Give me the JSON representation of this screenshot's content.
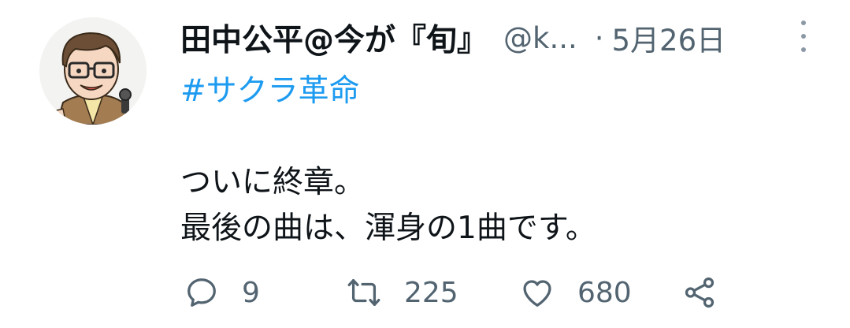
{
  "tweet": {
    "author": {
      "display_name": "田中公平@今が『旬』",
      "handle": "@k...",
      "avatar": "avatar-illustration"
    },
    "separator": "·",
    "date": "5月26日",
    "hashtag": "#サクラ革命",
    "lines": [
      "ついに終章。",
      "最後の曲は、渾身の1曲です。"
    ]
  },
  "actions": {
    "reply": {
      "icon": "reply-icon",
      "count": "9"
    },
    "retweet": {
      "icon": "retweet-icon",
      "count": "225"
    },
    "like": {
      "icon": "heart-icon",
      "count": "680"
    },
    "share": {
      "icon": "share-icon"
    }
  },
  "colors": {
    "text": "#0f1419",
    "secondary": "#536471",
    "link": "#1d9bf0",
    "background": "#ffffff"
  }
}
